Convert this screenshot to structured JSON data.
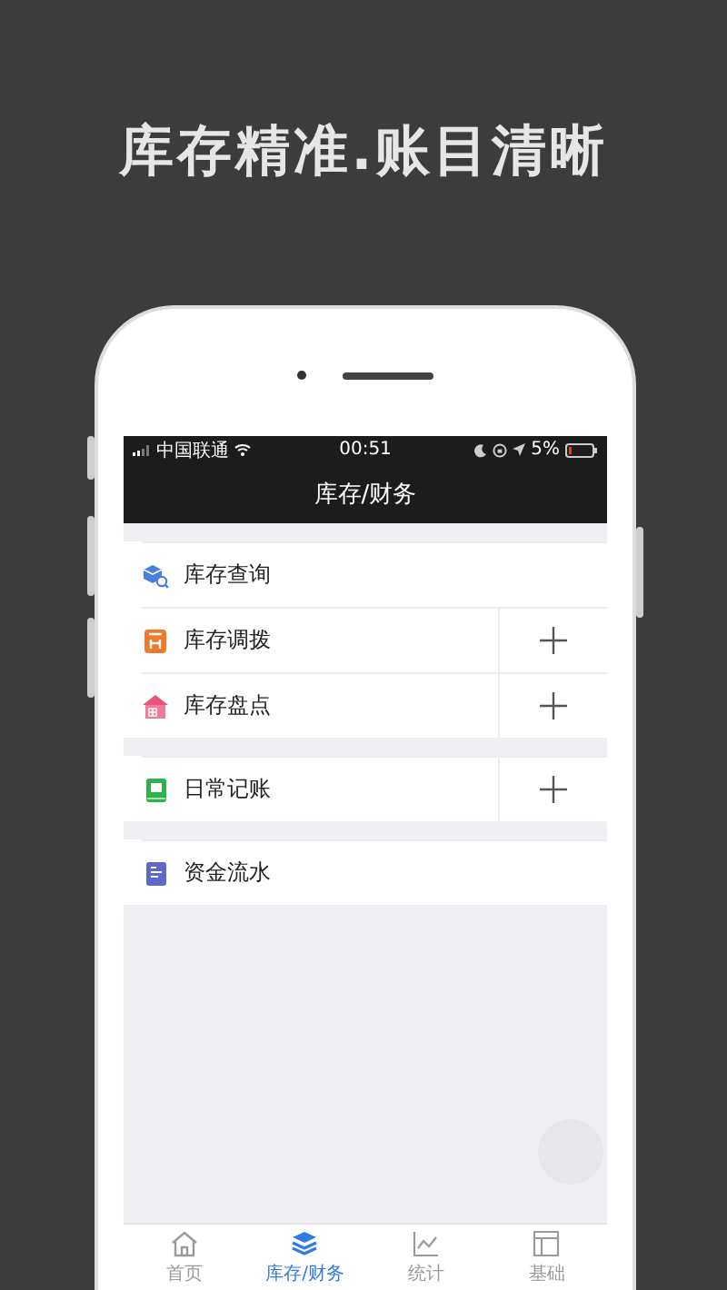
{
  "headline": "库存精准.账目清晰",
  "status_bar": {
    "carrier": "中国联通",
    "time": "00:51",
    "battery": "5%"
  },
  "nav_title": "库存/财务",
  "groups": [
    {
      "items": [
        {
          "label": "库存查询",
          "add": false
        },
        {
          "label": "库存调拨",
          "add": true
        },
        {
          "label": "库存盘点",
          "add": true
        }
      ]
    },
    {
      "items": [
        {
          "label": "日常记账",
          "add": true
        }
      ]
    },
    {
      "items": [
        {
          "label": "资金流水",
          "add": false
        }
      ]
    }
  ],
  "tabs": [
    {
      "label": "首页",
      "selected": false
    },
    {
      "label": "库存/财务",
      "selected": true
    },
    {
      "label": "统计",
      "selected": false
    },
    {
      "label": "基础",
      "selected": false
    }
  ]
}
